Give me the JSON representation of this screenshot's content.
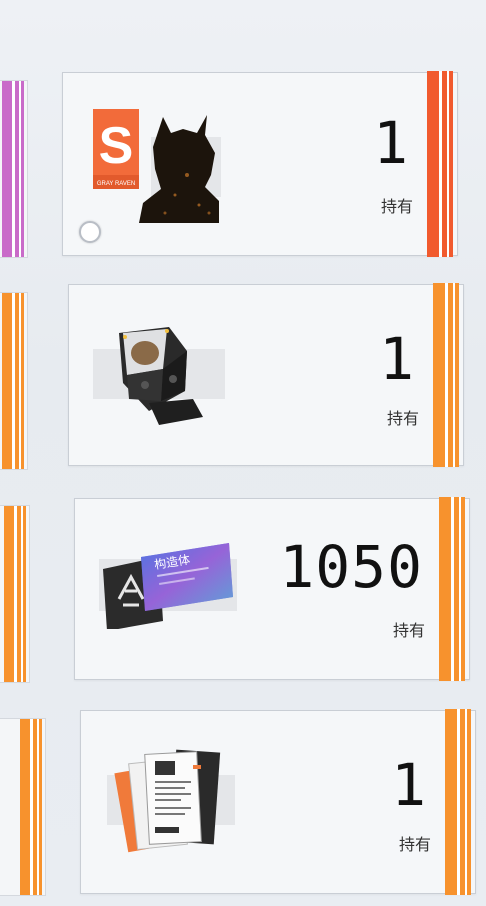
{
  "items": [
    {
      "name": "gray-raven-coating",
      "count": "1",
      "held_label": "持有",
      "rarity_color": "#f25a2e",
      "has_radio": true
    },
    {
      "name": "memory-core",
      "count": "1",
      "held_label": "持有",
      "rarity_color": "#f7922d",
      "has_radio": false
    },
    {
      "name": "construct-ticket",
      "count": "1050",
      "held_label": "持有",
      "rarity_color": "#f7922d",
      "has_radio": false,
      "ticket_text": "构造体"
    },
    {
      "name": "documents",
      "count": "1",
      "held_label": "持有",
      "rarity_color": "#f7922d",
      "has_radio": false
    }
  ],
  "logo": {
    "letter": "S",
    "caption": "GRAY RAVEN"
  },
  "side_colors": [
    "#c86ac8",
    "#f7922d",
    "#f7922d",
    "#f7922d"
  ]
}
